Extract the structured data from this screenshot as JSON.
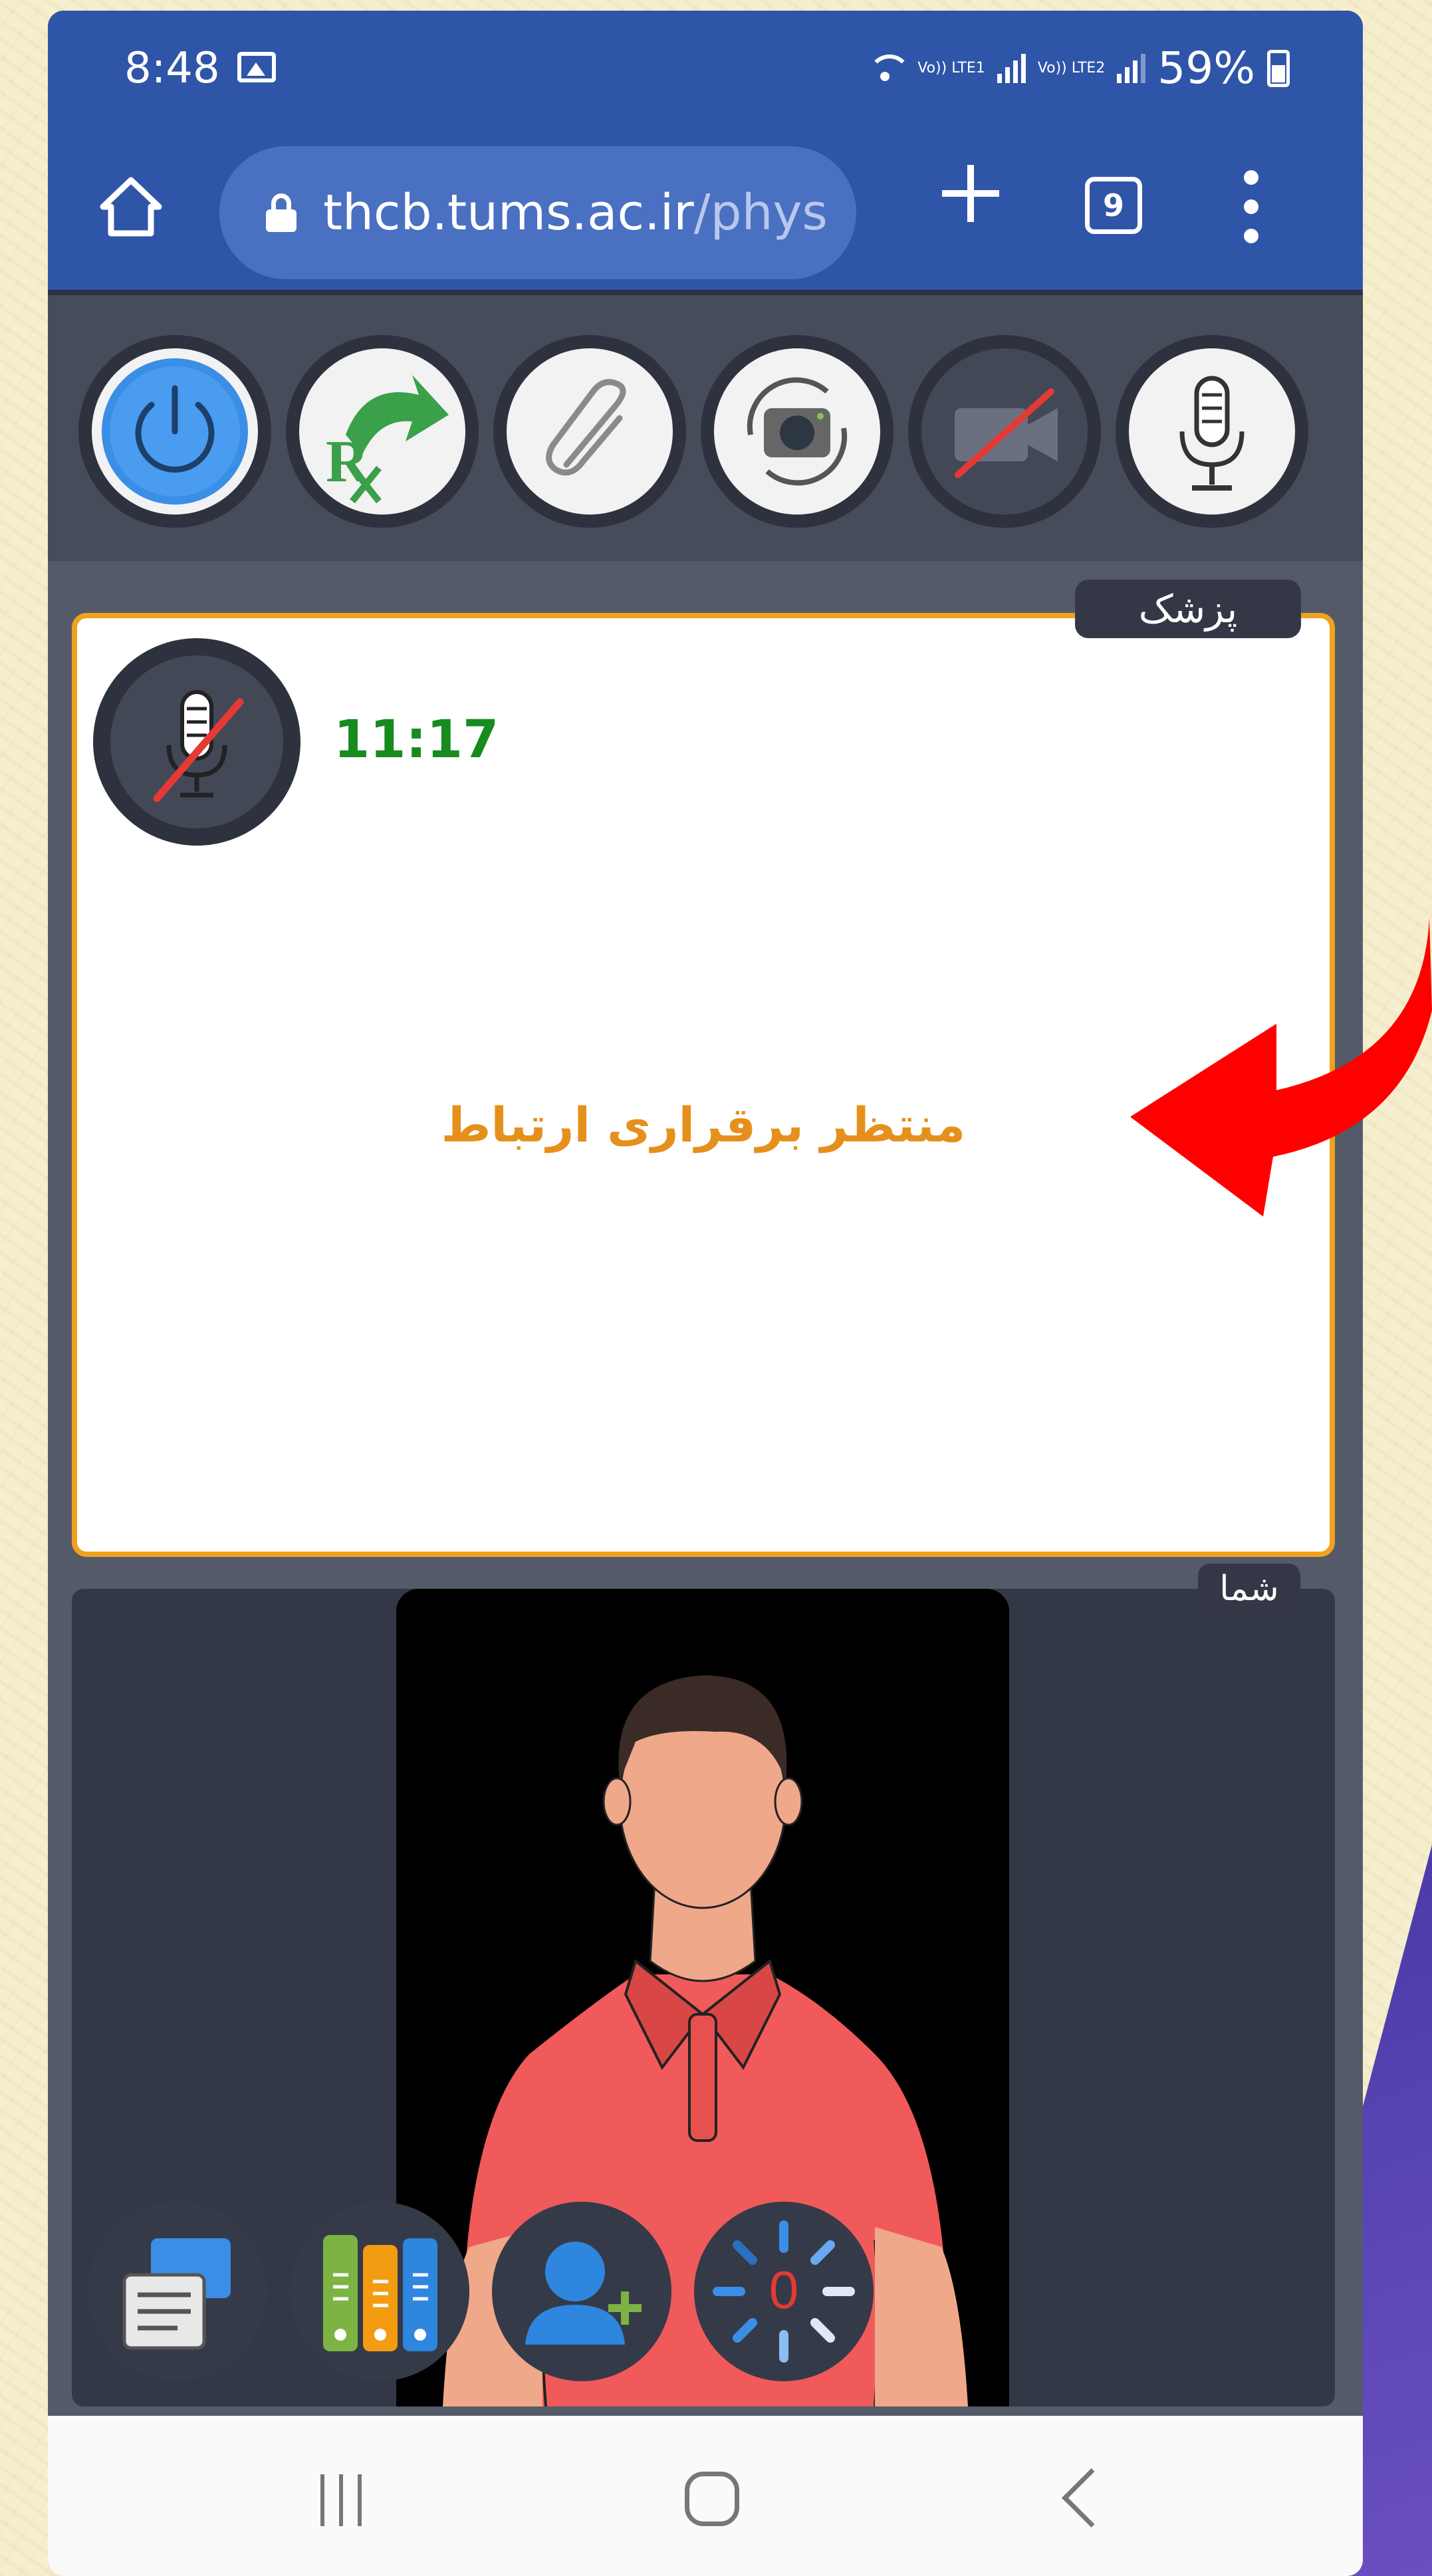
{
  "status_bar": {
    "time": "8:48",
    "lte1_label": "Vo)) LTE1",
    "lte2_label": "Vo)) LTE2",
    "battery": "59%"
  },
  "browser": {
    "url_host": "thcb.tums.ac.ir",
    "url_path": "/phys",
    "tab_count": "9"
  },
  "toolbar": {
    "buttons": [
      "power-icon",
      "prescription-icon",
      "attachment-icon",
      "switch-camera-icon",
      "video-off-icon",
      "microphone-icon"
    ]
  },
  "doctor_panel": {
    "tag": "پزشک",
    "timer": "11:17",
    "status_message": "منتظر برقراری ارتباط"
  },
  "self_panel": {
    "tag": "شما"
  },
  "bottom_actions": {
    "buttons": [
      "chat-icon",
      "records-icon",
      "add-person-icon",
      "loading-spinner-icon"
    ],
    "counter": "0"
  },
  "colors": {
    "browser_bar": "#2f55a9",
    "timer_green": "#178b1e",
    "waiting_orange": "#e6901c",
    "panel_border": "#f0a21e",
    "arrow_red": "#ff0000"
  }
}
